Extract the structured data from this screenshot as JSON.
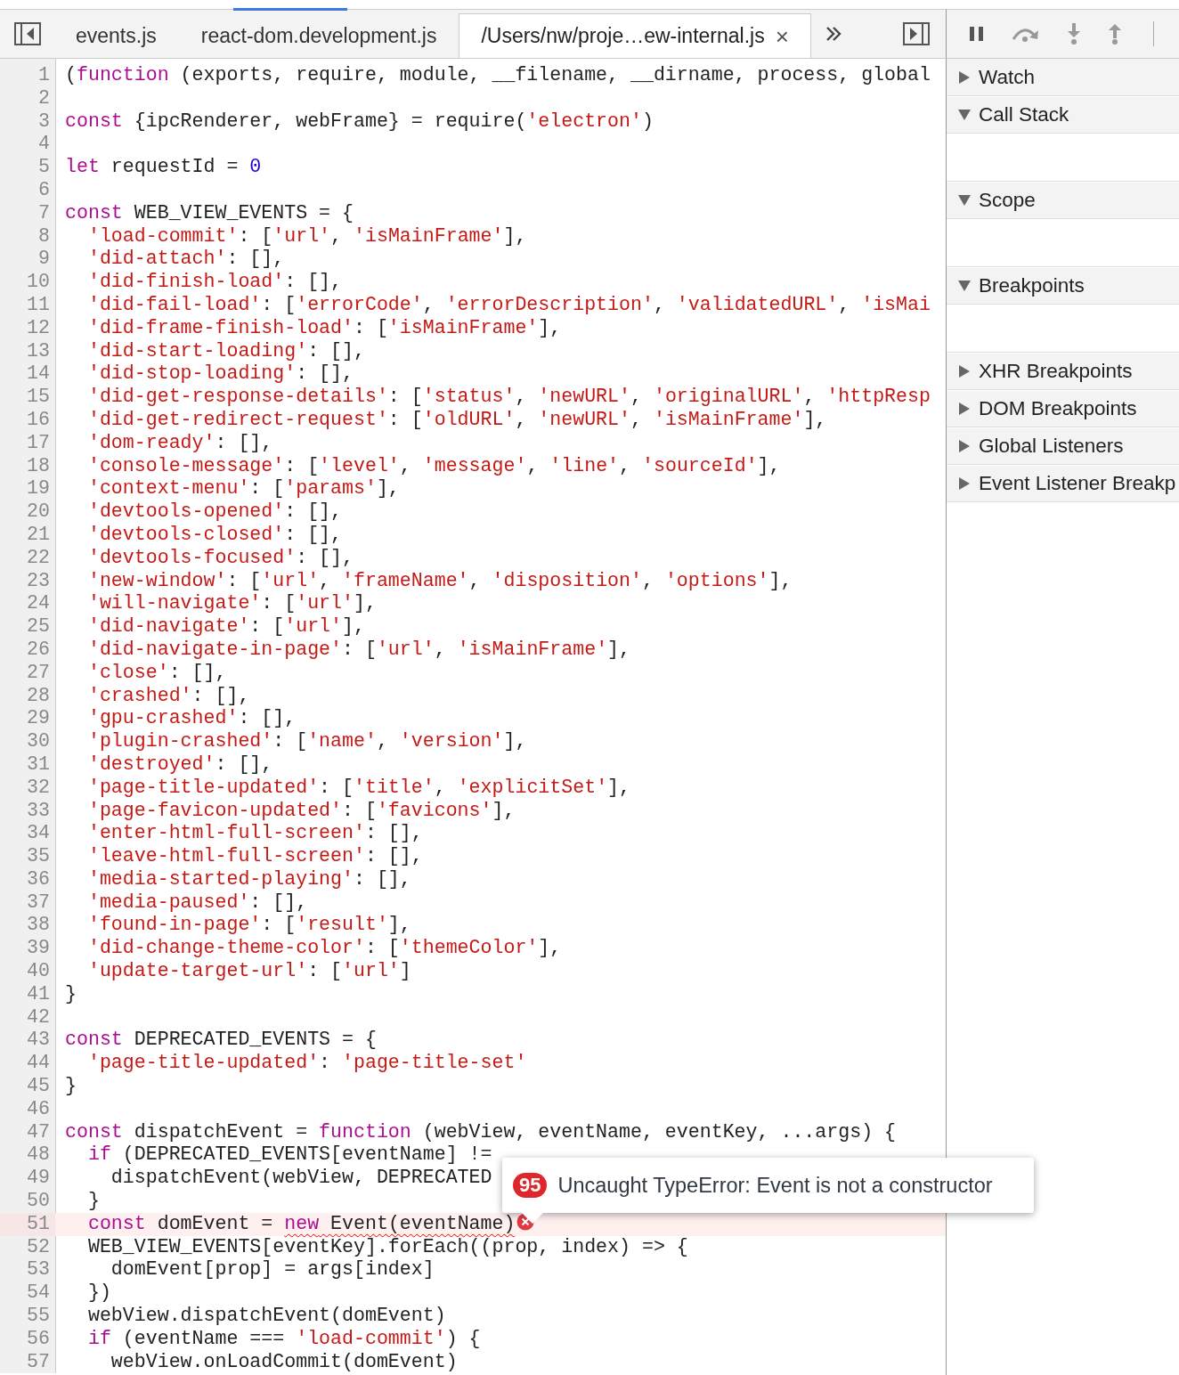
{
  "editor_tabs": [
    {
      "label": "events.js",
      "selected": false,
      "closable": false
    },
    {
      "label": "react-dom.development.js",
      "selected": false,
      "closable": false
    },
    {
      "label": "/Users/nw/proje…ew-internal.js",
      "selected": true,
      "closable": true,
      "close_glyph": "×"
    }
  ],
  "code_lines": [
    {
      "number": "1",
      "tokens": [
        {
          "kind": "plain",
          "text": "("
        },
        {
          "kind": "keyword",
          "text": "function"
        },
        {
          "kind": "plain",
          "text": " (exports, require, module, __filename, __dirname, process, global"
        }
      ]
    },
    {
      "number": "2"
    },
    {
      "number": "3",
      "tokens": [
        {
          "kind": "keyword",
          "text": "const"
        },
        {
          "kind": "plain",
          "text": " {ipcRenderer, webFrame} = require("
        },
        {
          "kind": "string",
          "text": "'electron'"
        },
        {
          "kind": "plain",
          "text": ")"
        }
      ]
    },
    {
      "number": "4"
    },
    {
      "number": "5",
      "tokens": [
        {
          "kind": "keyword",
          "text": "let"
        },
        {
          "kind": "plain",
          "text": " requestId = "
        },
        {
          "kind": "number",
          "text": "0"
        }
      ]
    },
    {
      "number": "6"
    },
    {
      "number": "7",
      "tokens": [
        {
          "kind": "keyword",
          "text": "const"
        },
        {
          "kind": "plain",
          "text": " WEB_VIEW_EVENTS = {"
        }
      ]
    },
    {
      "number": "8",
      "tokens": [
        {
          "kind": "string",
          "text": "  'load-commit'"
        },
        {
          "kind": "plain",
          "text": ": ["
        },
        {
          "kind": "string",
          "text": "'url'"
        },
        {
          "kind": "plain",
          "text": ", "
        },
        {
          "kind": "string",
          "text": "'isMainFrame'"
        },
        {
          "kind": "plain",
          "text": "],"
        }
      ]
    },
    {
      "number": "9",
      "tokens": [
        {
          "kind": "string",
          "text": "  'did-attach'"
        },
        {
          "kind": "plain",
          "text": ": [],"
        }
      ]
    },
    {
      "number": "10",
      "tokens": [
        {
          "kind": "string",
          "text": "  'did-finish-load'"
        },
        {
          "kind": "plain",
          "text": ": [],"
        }
      ]
    },
    {
      "number": "11",
      "tokens": [
        {
          "kind": "string",
          "text": "  'did-fail-load'"
        },
        {
          "kind": "plain",
          "text": ": ["
        },
        {
          "kind": "string",
          "text": "'errorCode'"
        },
        {
          "kind": "plain",
          "text": ", "
        },
        {
          "kind": "string",
          "text": "'errorDescription'"
        },
        {
          "kind": "plain",
          "text": ", "
        },
        {
          "kind": "string",
          "text": "'validatedURL'"
        },
        {
          "kind": "plain",
          "text": ", "
        },
        {
          "kind": "string",
          "text": "'isMai"
        }
      ]
    },
    {
      "number": "12",
      "tokens": [
        {
          "kind": "string",
          "text": "  'did-frame-finish-load'"
        },
        {
          "kind": "plain",
          "text": ": ["
        },
        {
          "kind": "string",
          "text": "'isMainFrame'"
        },
        {
          "kind": "plain",
          "text": "],"
        }
      ]
    },
    {
      "number": "13",
      "tokens": [
        {
          "kind": "string",
          "text": "  'did-start-loading'"
        },
        {
          "kind": "plain",
          "text": ": [],"
        }
      ]
    },
    {
      "number": "14",
      "tokens": [
        {
          "kind": "string",
          "text": "  'did-stop-loading'"
        },
        {
          "kind": "plain",
          "text": ": [],"
        }
      ]
    },
    {
      "number": "15",
      "tokens": [
        {
          "kind": "string",
          "text": "  'did-get-response-details'"
        },
        {
          "kind": "plain",
          "text": ": ["
        },
        {
          "kind": "string",
          "text": "'status'"
        },
        {
          "kind": "plain",
          "text": ", "
        },
        {
          "kind": "string",
          "text": "'newURL'"
        },
        {
          "kind": "plain",
          "text": ", "
        },
        {
          "kind": "string",
          "text": "'originalURL'"
        },
        {
          "kind": "plain",
          "text": ", "
        },
        {
          "kind": "string",
          "text": "'httpResp"
        }
      ]
    },
    {
      "number": "16",
      "tokens": [
        {
          "kind": "string",
          "text": "  'did-get-redirect-request'"
        },
        {
          "kind": "plain",
          "text": ": ["
        },
        {
          "kind": "string",
          "text": "'oldURL'"
        },
        {
          "kind": "plain",
          "text": ", "
        },
        {
          "kind": "string",
          "text": "'newURL'"
        },
        {
          "kind": "plain",
          "text": ", "
        },
        {
          "kind": "string",
          "text": "'isMainFrame'"
        },
        {
          "kind": "plain",
          "text": "],"
        }
      ]
    },
    {
      "number": "17",
      "tokens": [
        {
          "kind": "string",
          "text": "  'dom-ready'"
        },
        {
          "kind": "plain",
          "text": ": [],"
        }
      ]
    },
    {
      "number": "18",
      "tokens": [
        {
          "kind": "string",
          "text": "  'console-message'"
        },
        {
          "kind": "plain",
          "text": ": ["
        },
        {
          "kind": "string",
          "text": "'level'"
        },
        {
          "kind": "plain",
          "text": ", "
        },
        {
          "kind": "string",
          "text": "'message'"
        },
        {
          "kind": "plain",
          "text": ", "
        },
        {
          "kind": "string",
          "text": "'line'"
        },
        {
          "kind": "plain",
          "text": ", "
        },
        {
          "kind": "string",
          "text": "'sourceId'"
        },
        {
          "kind": "plain",
          "text": "],"
        }
      ]
    },
    {
      "number": "19",
      "tokens": [
        {
          "kind": "string",
          "text": "  'context-menu'"
        },
        {
          "kind": "plain",
          "text": ": ["
        },
        {
          "kind": "string",
          "text": "'params'"
        },
        {
          "kind": "plain",
          "text": "],"
        }
      ]
    },
    {
      "number": "20",
      "tokens": [
        {
          "kind": "string",
          "text": "  'devtools-opened'"
        },
        {
          "kind": "plain",
          "text": ": [],"
        }
      ]
    },
    {
      "number": "21",
      "tokens": [
        {
          "kind": "string",
          "text": "  'devtools-closed'"
        },
        {
          "kind": "plain",
          "text": ": [],"
        }
      ]
    },
    {
      "number": "22",
      "tokens": [
        {
          "kind": "string",
          "text": "  'devtools-focused'"
        },
        {
          "kind": "plain",
          "text": ": [],"
        }
      ]
    },
    {
      "number": "23",
      "tokens": [
        {
          "kind": "string",
          "text": "  'new-window'"
        },
        {
          "kind": "plain",
          "text": ": ["
        },
        {
          "kind": "string",
          "text": "'url'"
        },
        {
          "kind": "plain",
          "text": ", "
        },
        {
          "kind": "string",
          "text": "'frameName'"
        },
        {
          "kind": "plain",
          "text": ", "
        },
        {
          "kind": "string",
          "text": "'disposition'"
        },
        {
          "kind": "plain",
          "text": ", "
        },
        {
          "kind": "string",
          "text": "'options'"
        },
        {
          "kind": "plain",
          "text": "],"
        }
      ]
    },
    {
      "number": "24",
      "tokens": [
        {
          "kind": "string",
          "text": "  'will-navigate'"
        },
        {
          "kind": "plain",
          "text": ": ["
        },
        {
          "kind": "string",
          "text": "'url'"
        },
        {
          "kind": "plain",
          "text": "],"
        }
      ]
    },
    {
      "number": "25",
      "tokens": [
        {
          "kind": "string",
          "text": "  'did-navigate'"
        },
        {
          "kind": "plain",
          "text": ": ["
        },
        {
          "kind": "string",
          "text": "'url'"
        },
        {
          "kind": "plain",
          "text": "],"
        }
      ]
    },
    {
      "number": "26",
      "tokens": [
        {
          "kind": "string",
          "text": "  'did-navigate-in-page'"
        },
        {
          "kind": "plain",
          "text": ": ["
        },
        {
          "kind": "string",
          "text": "'url'"
        },
        {
          "kind": "plain",
          "text": ", "
        },
        {
          "kind": "string",
          "text": "'isMainFrame'"
        },
        {
          "kind": "plain",
          "text": "],"
        }
      ]
    },
    {
      "number": "27",
      "tokens": [
        {
          "kind": "string",
          "text": "  'close'"
        },
        {
          "kind": "plain",
          "text": ": [],"
        }
      ]
    },
    {
      "number": "28",
      "tokens": [
        {
          "kind": "string",
          "text": "  'crashed'"
        },
        {
          "kind": "plain",
          "text": ": [],"
        }
      ]
    },
    {
      "number": "29",
      "tokens": [
        {
          "kind": "string",
          "text": "  'gpu-crashed'"
        },
        {
          "kind": "plain",
          "text": ": [],"
        }
      ]
    },
    {
      "number": "30",
      "tokens": [
        {
          "kind": "string",
          "text": "  'plugin-crashed'"
        },
        {
          "kind": "plain",
          "text": ": ["
        },
        {
          "kind": "string",
          "text": "'name'"
        },
        {
          "kind": "plain",
          "text": ", "
        },
        {
          "kind": "string",
          "text": "'version'"
        },
        {
          "kind": "plain",
          "text": "],"
        }
      ]
    },
    {
      "number": "31",
      "tokens": [
        {
          "kind": "string",
          "text": "  'destroyed'"
        },
        {
          "kind": "plain",
          "text": ": [],"
        }
      ]
    },
    {
      "number": "32",
      "tokens": [
        {
          "kind": "string",
          "text": "  'page-title-updated'"
        },
        {
          "kind": "plain",
          "text": ": ["
        },
        {
          "kind": "string",
          "text": "'title'"
        },
        {
          "kind": "plain",
          "text": ", "
        },
        {
          "kind": "string",
          "text": "'explicitSet'"
        },
        {
          "kind": "plain",
          "text": "],"
        }
      ]
    },
    {
      "number": "33",
      "tokens": [
        {
          "kind": "string",
          "text": "  'page-favicon-updated'"
        },
        {
          "kind": "plain",
          "text": ": ["
        },
        {
          "kind": "string",
          "text": "'favicons'"
        },
        {
          "kind": "plain",
          "text": "],"
        }
      ]
    },
    {
      "number": "34",
      "tokens": [
        {
          "kind": "string",
          "text": "  'enter-html-full-screen'"
        },
        {
          "kind": "plain",
          "text": ": [],"
        }
      ]
    },
    {
      "number": "35",
      "tokens": [
        {
          "kind": "string",
          "text": "  'leave-html-full-screen'"
        },
        {
          "kind": "plain",
          "text": ": [],"
        }
      ]
    },
    {
      "number": "36",
      "tokens": [
        {
          "kind": "string",
          "text": "  'media-started-playing'"
        },
        {
          "kind": "plain",
          "text": ": [],"
        }
      ]
    },
    {
      "number": "37",
      "tokens": [
        {
          "kind": "string",
          "text": "  'media-paused'"
        },
        {
          "kind": "plain",
          "text": ": [],"
        }
      ]
    },
    {
      "number": "38",
      "tokens": [
        {
          "kind": "string",
          "text": "  'found-in-page'"
        },
        {
          "kind": "plain",
          "text": ": ["
        },
        {
          "kind": "string",
          "text": "'result'"
        },
        {
          "kind": "plain",
          "text": "],"
        }
      ]
    },
    {
      "number": "39",
      "tokens": [
        {
          "kind": "string",
          "text": "  'did-change-theme-color'"
        },
        {
          "kind": "plain",
          "text": ": ["
        },
        {
          "kind": "string",
          "text": "'themeColor'"
        },
        {
          "kind": "plain",
          "text": "],"
        }
      ]
    },
    {
      "number": "40",
      "tokens": [
        {
          "kind": "string",
          "text": "  'update-target-url'"
        },
        {
          "kind": "plain",
          "text": ": ["
        },
        {
          "kind": "string",
          "text": "'url'"
        },
        {
          "kind": "plain",
          "text": "]"
        }
      ]
    },
    {
      "number": "41",
      "tokens": [
        {
          "kind": "plain",
          "text": "}"
        }
      ]
    },
    {
      "number": "42"
    },
    {
      "number": "43",
      "tokens": [
        {
          "kind": "keyword",
          "text": "const"
        },
        {
          "kind": "plain",
          "text": " DEPRECATED_EVENTS = {"
        }
      ]
    },
    {
      "number": "44",
      "tokens": [
        {
          "kind": "string",
          "text": "  'page-title-updated'"
        },
        {
          "kind": "plain",
          "text": ": "
        },
        {
          "kind": "string",
          "text": "'page-title-set'"
        }
      ]
    },
    {
      "number": "45",
      "tokens": [
        {
          "kind": "plain",
          "text": "}"
        }
      ]
    },
    {
      "number": "46"
    },
    {
      "number": "47",
      "tokens": [
        {
          "kind": "keyword",
          "text": "const"
        },
        {
          "kind": "plain",
          "text": " dispatchEvent = "
        },
        {
          "kind": "keyword",
          "text": "function"
        },
        {
          "kind": "plain",
          "text": " (webView, eventName, eventKey, ...args) {"
        }
      ]
    },
    {
      "number": "48",
      "tokens": [
        {
          "kind": "keyword",
          "text": "  if"
        },
        {
          "kind": "plain",
          "text": " (DEPRECATED_EVENTS[eventName] !="
        }
      ]
    },
    {
      "number": "49",
      "tokens": [
        {
          "kind": "plain",
          "text": "    dispatchEvent(webView, DEPRECATED"
        }
      ]
    },
    {
      "number": "50",
      "tokens": [
        {
          "kind": "plain",
          "text": "  }"
        }
      ]
    },
    {
      "number": "51",
      "error": true,
      "tokens": [
        {
          "kind": "keyword",
          "text": "  const"
        },
        {
          "kind": "plain",
          "text": " domEvent = "
        },
        {
          "kind": "keyword",
          "text": "new",
          "squiggle": true
        },
        {
          "kind": "plain",
          "text": " Event(eventName)",
          "squiggle": true
        }
      ]
    },
    {
      "number": "52",
      "tokens": [
        {
          "kind": "plain",
          "text": "  WEB_VIEW_EVENTS[eventKey].forEach((prop, index) => {"
        }
      ]
    },
    {
      "number": "53",
      "tokens": [
        {
          "kind": "plain",
          "text": "    domEvent[prop] = args[index]"
        }
      ]
    },
    {
      "number": "54",
      "tokens": [
        {
          "kind": "plain",
          "text": "  })"
        }
      ]
    },
    {
      "number": "55",
      "tokens": [
        {
          "kind": "plain",
          "text": "  webView.dispatchEvent(domEvent)"
        }
      ]
    },
    {
      "number": "56",
      "tokens": [
        {
          "kind": "keyword",
          "text": "  if"
        },
        {
          "kind": "plain",
          "text": " (eventName === "
        },
        {
          "kind": "string",
          "text": "'load-commit'"
        },
        {
          "kind": "plain",
          "text": ") {"
        }
      ]
    },
    {
      "number": "57",
      "tokens": [
        {
          "kind": "plain",
          "text": "    webView.onLoadCommit(domEvent)"
        }
      ]
    }
  ],
  "error_tooltip": {
    "count": "95",
    "message": "Uncaught TypeError: Event is not a constructor"
  },
  "sidebar": {
    "sections": [
      {
        "title": "Watch",
        "expanded": false
      },
      {
        "title": "Call Stack",
        "expanded": true
      },
      {
        "title": "Scope",
        "expanded": true
      },
      {
        "title": "Breakpoints",
        "expanded": true
      },
      {
        "title": "XHR Breakpoints",
        "expanded": false
      },
      {
        "title": "DOM Breakpoints",
        "expanded": false
      },
      {
        "title": "Global Listeners",
        "expanded": false
      },
      {
        "title": "Event Listener Breakp",
        "expanded": false
      }
    ]
  }
}
